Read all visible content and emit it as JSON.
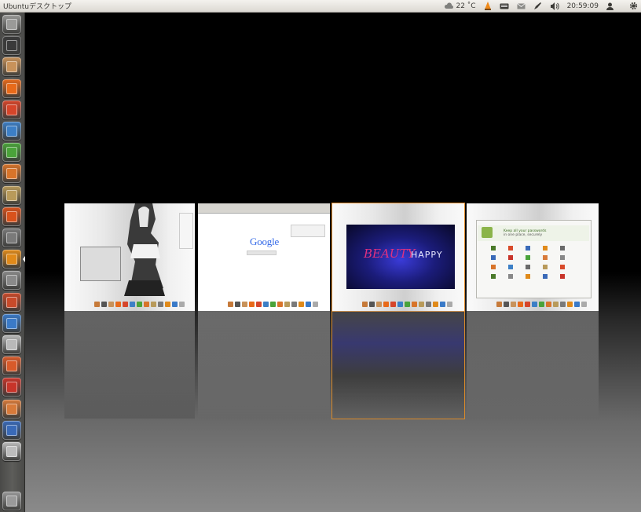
{
  "panel": {
    "title": "Ubuntuデスクトップ",
    "weather": "22 ˚C",
    "clock": "20:59:09"
  },
  "launcher": {
    "items": [
      {
        "name": "dash-home",
        "color": "#9a9a98"
      },
      {
        "name": "terminal",
        "color": "#3a3a3a"
      },
      {
        "name": "files",
        "color": "#c8925a"
      },
      {
        "name": "firefox",
        "color": "#e86a1a"
      },
      {
        "name": "software-center",
        "color": "#d6452a"
      },
      {
        "name": "libreoffice-writer",
        "color": "#3c7fc6"
      },
      {
        "name": "libreoffice-calc",
        "color": "#4aa33a"
      },
      {
        "name": "libreoffice-impress",
        "color": "#d8742a"
      },
      {
        "name": "archive-manager",
        "color": "#b89a5a"
      },
      {
        "name": "ubuntu-one",
        "color": "#d8521c"
      },
      {
        "name": "startup-disk",
        "color": "#7a7a7a"
      },
      {
        "name": "vlc",
        "color": "#e08a1a"
      },
      {
        "name": "settings",
        "color": "#8a8a8a"
      },
      {
        "name": "image-viewer",
        "color": "#c94a2a"
      },
      {
        "name": "update-manager",
        "color": "#3a7ac8"
      },
      {
        "name": "text-editor",
        "color": "#b9b9b9"
      },
      {
        "name": "eye-app",
        "color": "#d85a2a"
      },
      {
        "name": "ubuntu-tweak",
        "color": "#c8342a"
      },
      {
        "name": "chromium",
        "color": "#d87a3a"
      },
      {
        "name": "workspace-switcher",
        "color": "#3a6ab8"
      },
      {
        "name": "drive",
        "color": "#bdbdbd"
      },
      {
        "name": "trash",
        "color": "#9a9a9a"
      }
    ],
    "active_index": 11
  },
  "spread": {
    "windows": [
      {
        "name": "desktop-photo-window",
        "selected": false
      },
      {
        "name": "google-browser-window",
        "selected": false
      },
      {
        "name": "video-player-window",
        "selected": true
      },
      {
        "name": "password-manager-window",
        "selected": false
      }
    ],
    "google_logo": "Google",
    "video_title_pink": "BEAUTY",
    "video_title_white": "HAPPY",
    "pm_headline": "Keep all your passwords",
    "pm_subline": "in one place, securely"
  }
}
